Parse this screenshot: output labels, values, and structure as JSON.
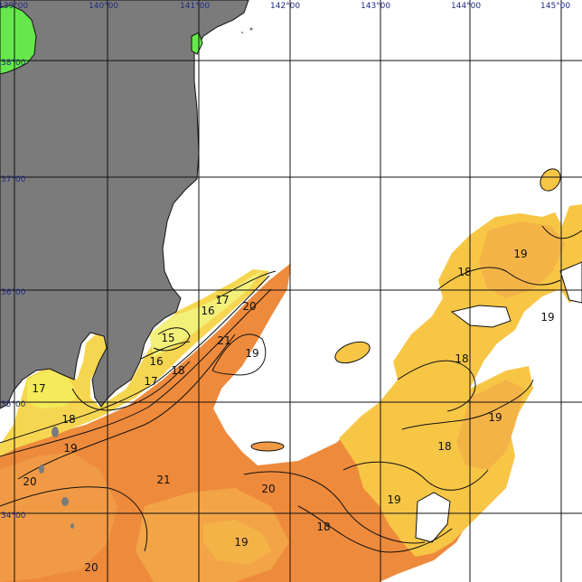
{
  "map": {
    "longitude_labels": [
      "139°00",
      "140°00",
      "141°00",
      "142°00",
      "143°00",
      "144°00",
      "145°00"
    ],
    "latitude_labels": [
      "38°00",
      "37°00",
      "36°00",
      "35°00",
      "34°00"
    ],
    "isotherm_labels": [
      "15",
      "16",
      "16",
      "17",
      "17",
      "17",
      "18",
      "18",
      "18",
      "18",
      "18",
      "18",
      "19",
      "19",
      "19",
      "19",
      "19",
      "19",
      "20",
      "20",
      "20",
      "20",
      "21",
      "21"
    ],
    "colors": {
      "land": "#7b7b7b",
      "land_green": "#66e84c",
      "sst_15": "#f3f07a",
      "sst_17": "#f4ea5a",
      "sst_18": "#f7c645",
      "sst_19": "#f4b347",
      "sst_20": "#f09a45",
      "sst_21": "#ee8a3c",
      "grid": "#111111",
      "label_text": "#1f2a80"
    }
  }
}
